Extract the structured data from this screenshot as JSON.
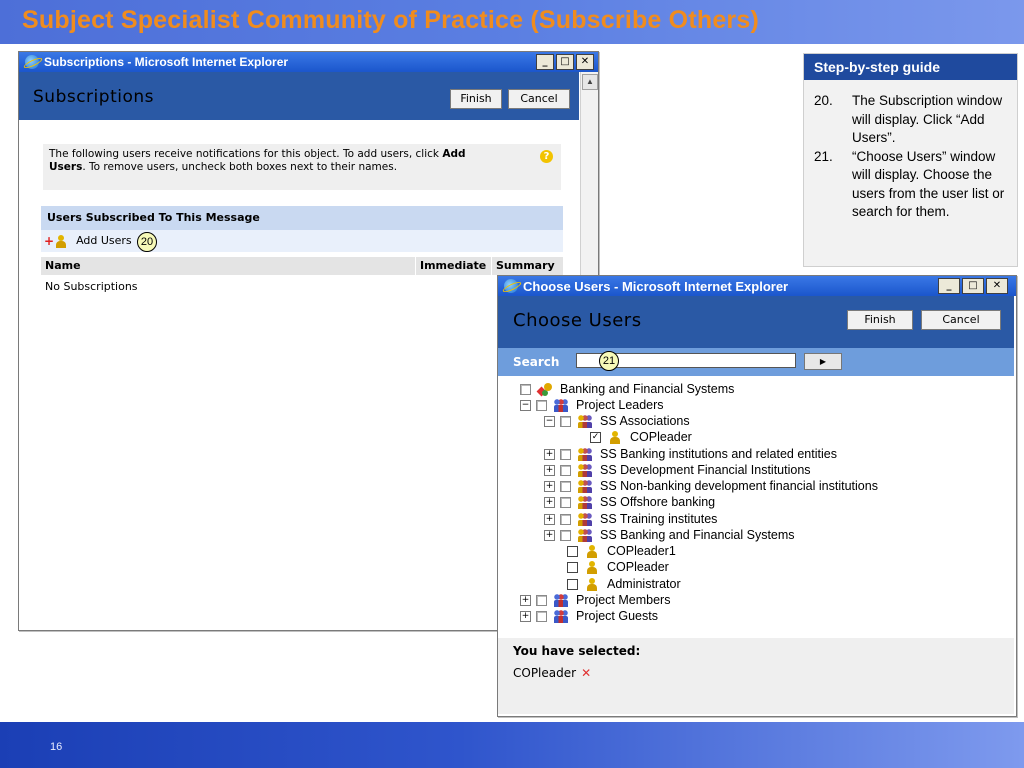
{
  "slide": {
    "title": "Subject Specialist Community of Practice (Subscribe Others)",
    "page_number": "16"
  },
  "subscriptions_window": {
    "titlebar": "Subscriptions - Microsoft Internet Explorer",
    "header_title": "Subscriptions",
    "finish_label": "Finish",
    "cancel_label": "Cancel",
    "info_text_1": "The following users receive notifications for this object. To add users, click ",
    "info_text_bold": "Add Users",
    "info_text_2": ". To remove users, uncheck both boxes next to their names.",
    "section_title": "Users Subscribed To This Message",
    "add_users_label": "Add Users",
    "columns": [
      "Name",
      "Immediate",
      "Summary"
    ],
    "empty_text": "No Subscriptions"
  },
  "callouts": {
    "step20": "20",
    "step21": "21"
  },
  "guide": {
    "heading": "Step-by-step guide",
    "steps": [
      {
        "num": "20.",
        "text": "The Subscription window will display. Click “Add Users”."
      },
      {
        "num": "21.",
        "text": "“Choose Users” window will display. Choose the users from the user list or search for them."
      }
    ]
  },
  "choose_window": {
    "titlebar": "Choose Users - Microsoft Internet Explorer",
    "header_title": "Choose Users",
    "finish_label": "Finish",
    "cancel_label": "Cancel",
    "search_label": "Search",
    "search_value": "",
    "tree": [
      {
        "label": "Banking and Financial Systems",
        "icon": "community-icon"
      },
      {
        "label": "Project Leaders",
        "icon": "role-icon"
      },
      {
        "label": "SS Associations",
        "icon": "group-icon"
      },
      {
        "label": "COPleader",
        "icon": "user-icon",
        "checked": true
      },
      {
        "label": "SS Banking institutions and related entities",
        "icon": "group-icon"
      },
      {
        "label": "SS Development Financial Institutions",
        "icon": "group-icon"
      },
      {
        "label": "SS Non-banking development financial institutions",
        "icon": "group-icon"
      },
      {
        "label": "SS Offshore banking",
        "icon": "group-icon"
      },
      {
        "label": "SS Training institutes",
        "icon": "group-icon"
      },
      {
        "label": "SS Banking and Financial Systems",
        "icon": "group-icon"
      },
      {
        "label": "COPleader1",
        "icon": "user-icon"
      },
      {
        "label": "COPleader",
        "icon": "user-icon"
      },
      {
        "label": "Administrator",
        "icon": "user-icon"
      },
      {
        "label": "Project Members",
        "icon": "role-icon"
      },
      {
        "label": "Project Guests",
        "icon": "role-icon"
      }
    ],
    "selected_label": "You have selected:",
    "selected_items": [
      "COPleader"
    ]
  },
  "colors": {
    "title_orange": "#f08c1e",
    "header_blue": "#2a59a5",
    "guide_blue": "#1f4a9e"
  }
}
